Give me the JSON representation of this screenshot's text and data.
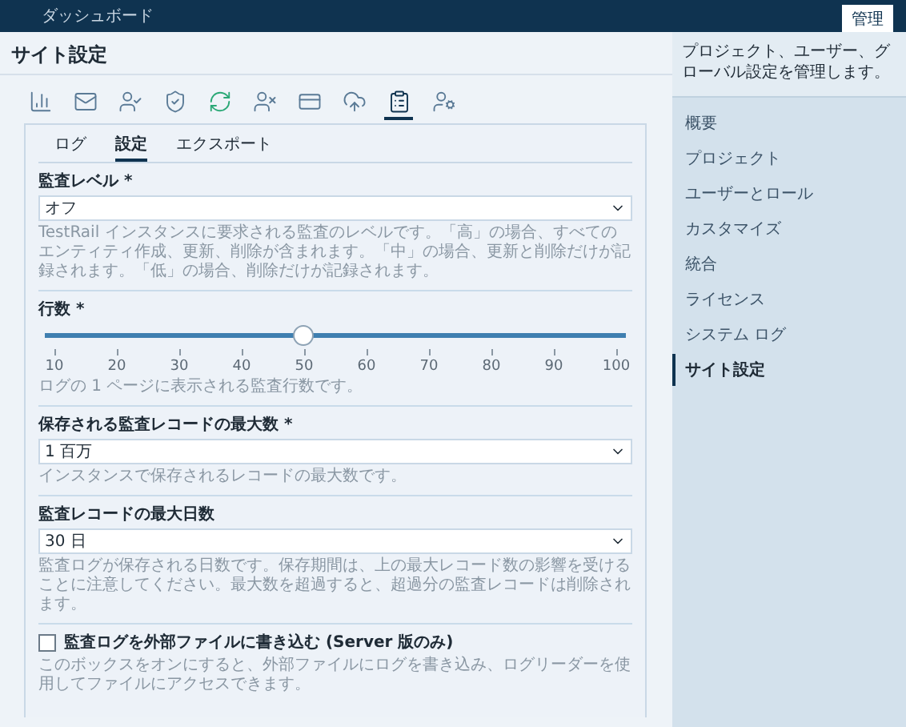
{
  "header": {
    "tabs": [
      {
        "label": "ダッシュボード",
        "selected": false
      },
      {
        "label": "管理",
        "selected": true
      }
    ]
  },
  "page_title": "サイト設定",
  "toolbar": [
    {
      "selected": false
    },
    {
      "selected": false
    },
    {
      "selected": false
    },
    {
      "selected": false
    },
    {
      "selected": false
    },
    {
      "selected": false
    },
    {
      "selected": false
    },
    {
      "selected": false
    },
    {
      "selected": true
    },
    {
      "selected": false
    }
  ],
  "sub_tabs": [
    {
      "label": "ログ",
      "selected": false
    },
    {
      "label": "設定",
      "selected": true
    },
    {
      "label": "エクスポート",
      "selected": false
    }
  ],
  "settings": [
    {
      "kind": "select",
      "label": "監査レベル *",
      "value": "オフ",
      "description": "TestRail インスタンスに要求される監査のレベルです。「高」の場合、すべてのエンティティ作成、更新、削除が含まれます。「中」の場合、更新と削除だけが記録されます。「低」の場合、削除だけが記録されます。"
    },
    {
      "kind": "slider",
      "label": "行数 *",
      "level": 0.444,
      "ticks": [
        "10",
        "20",
        "30",
        "40",
        "50",
        "60",
        "70",
        "80",
        "90",
        "100"
      ],
      "description": "ログの 1 ページに表示される監査行数です。"
    },
    {
      "kind": "select",
      "label": "保存される監査レコードの最大数 *",
      "value": "1 百万",
      "description": "インスタンスで保存されるレコードの最大数です。"
    },
    {
      "kind": "select",
      "label": "監査レコードの最大日数",
      "value": "30 日",
      "description": "監査ログが保存される日数です。保存期間は、上の最大レコード数の影響を受けることに注意してください。最大数を超過すると、超過分の監査レコードは削除されます。"
    },
    {
      "kind": "checkbox",
      "label": "監査ログを外部ファイルに書き込む (Server 版のみ)",
      "checked": false,
      "description": "このボックスをオンにすると、外部ファイルにログを書き込み、ログリーダーを使用してファイルにアクセスできます。"
    }
  ],
  "sidebar": {
    "description": "プロジェクト、ユーザー、グローバル設定を管理します。",
    "items": [
      {
        "label": "概要",
        "selected": false
      },
      {
        "label": "プロジェクト",
        "selected": false
      },
      {
        "label": "ユーザーとロール",
        "selected": false
      },
      {
        "label": "カスタマイズ",
        "selected": false
      },
      {
        "label": "統合",
        "selected": false
      },
      {
        "label": "ライセンス",
        "selected": false
      },
      {
        "label": "システム ログ",
        "selected": false
      },
      {
        "label": "サイト設定",
        "selected": true
      }
    ]
  }
}
